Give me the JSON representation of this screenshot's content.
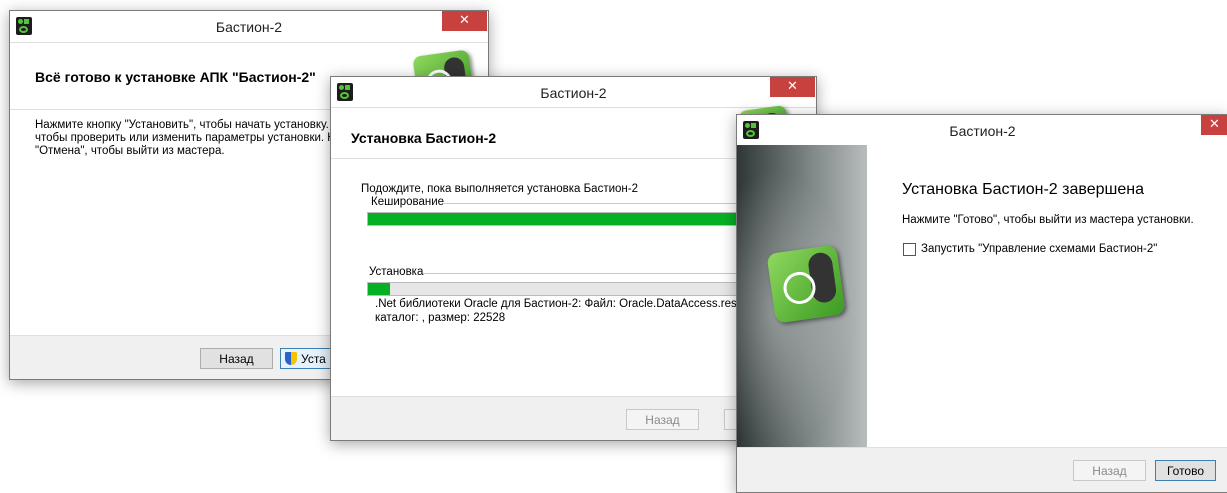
{
  "window1": {
    "title": "Бастион-2",
    "close_glyph": "✕",
    "header_title": "Всё готово к установке АПК \"Бастион-2\"",
    "body_lines": [
      "Нажмите кнопку \"Установить\", чтобы начать установку.",
      "чтобы проверить или изменить параметры установки. Н",
      "\"Отмена\", чтобы выйти из мастера."
    ],
    "back_button": "Назад",
    "install_button": "Уста",
    "install_icon": "uac-shield-icon"
  },
  "window2": {
    "title": "Бастион-2",
    "close_glyph": "✕",
    "header_title": "Установка Бастион-2",
    "status_text": "Подождите, пока выполняется установка Бастион-2",
    "caching_label": "Кеширование",
    "caching_progress": 1.0,
    "install_label": "Установка",
    "install_progress": 0.05,
    "detail_line1": ".Net библиотеки Oracle для Бастион-2: Файл: Oracle.DataAccess.resourc",
    "detail_line2": "каталог: ,  размер: 22528",
    "back_button": "Назад"
  },
  "window3": {
    "title": "Бастион-2",
    "close_glyph": "✕",
    "heading": "Установка Бастион-2 завершена",
    "instruction": "Нажмите \"Готово\", чтобы выйти из мастера установки.",
    "checkbox_label": "Запустить \"Управление схемами Бастион-2\"",
    "checkbox_checked": false,
    "back_button": "Назад",
    "finish_button": "Готово"
  },
  "colors": {
    "progress_green": "#06b025",
    "close_red": "#c7413f"
  }
}
